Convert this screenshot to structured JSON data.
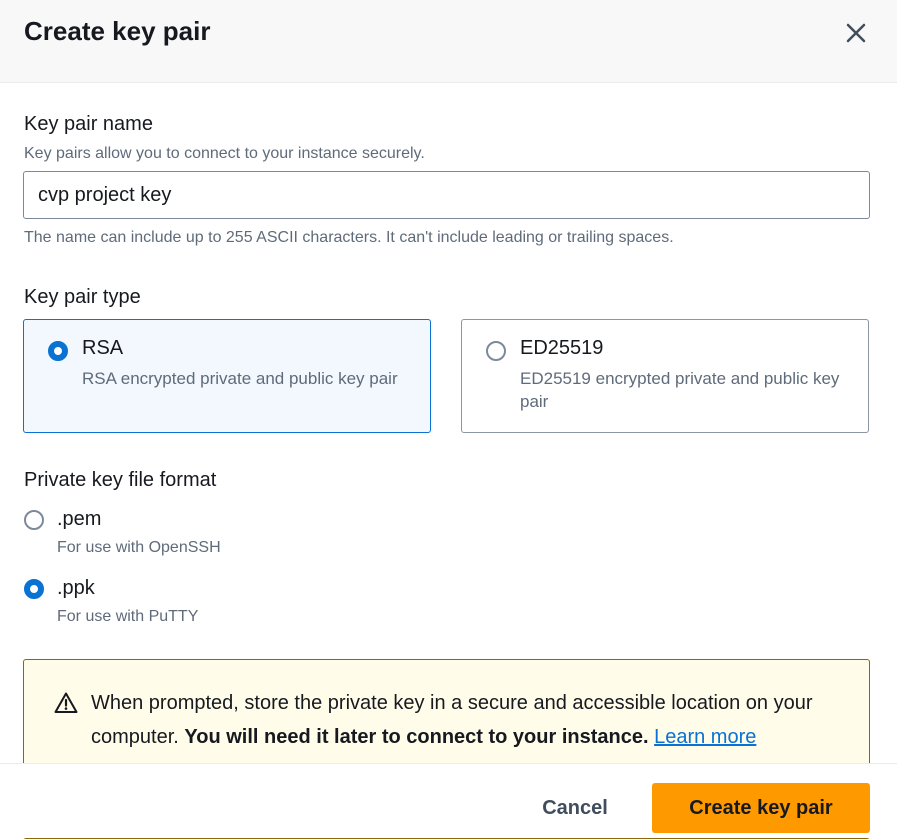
{
  "modal": {
    "title": "Create key pair",
    "close_icon": "close-icon"
  },
  "key_pair_name": {
    "label": "Key pair name",
    "description": "Key pairs allow you to connect to your instance securely.",
    "value": "cvp project key",
    "constraint": "The name can include up to 255 ASCII characters. It can't include leading or trailing spaces."
  },
  "key_pair_type": {
    "label": "Key pair type",
    "options": [
      {
        "title": "RSA",
        "description": "RSA encrypted private and public key pair",
        "selected": true
      },
      {
        "title": "ED25519",
        "description": "ED25519 encrypted private and public key pair",
        "selected": false
      }
    ]
  },
  "file_format": {
    "label": "Private key file format",
    "options": [
      {
        "title": ".pem",
        "description": "For use with OpenSSH",
        "selected": false
      },
      {
        "title": ".ppk",
        "description": "For use with PuTTY",
        "selected": true
      }
    ]
  },
  "alert": {
    "icon": "warning-icon",
    "text_start": "When prompted, store the private key in a secure and accessible location on your computer. ",
    "text_bold": "You will need it later to connect to your instance.",
    "link_text": "Learn more"
  },
  "footer": {
    "cancel_label": "Cancel",
    "create_label": "Create key pair"
  },
  "colors": {
    "accent": "#0972d3",
    "primary_button": "#ff9900",
    "alert_background": "#fffce9",
    "alert_border": "#8d6605"
  }
}
